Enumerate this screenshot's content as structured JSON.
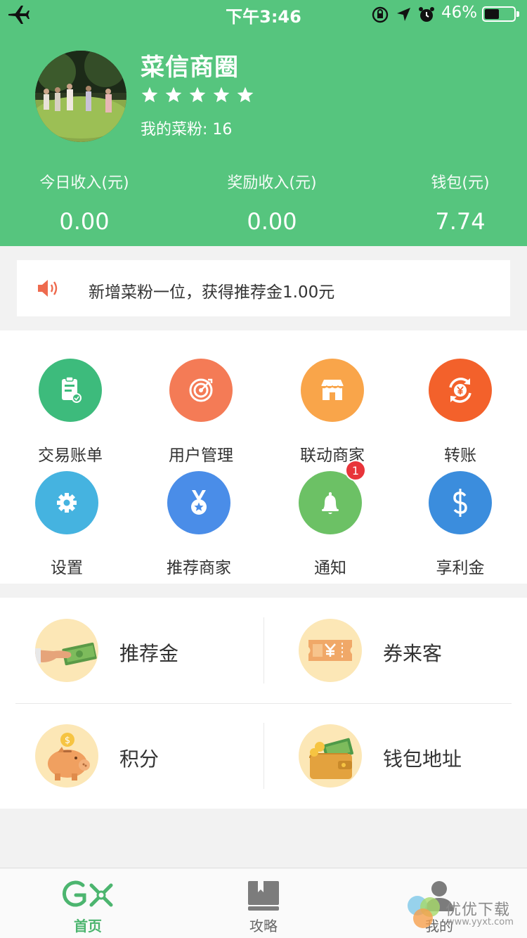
{
  "status_bar": {
    "time": "下午3:46",
    "battery": "46%"
  },
  "profile": {
    "name": "菜信商圈",
    "rating": 5,
    "fans_label": "我的菜粉: 16"
  },
  "stats": [
    {
      "label": "今日收入(元)",
      "value": "0.00"
    },
    {
      "label": "奖励收入(元)",
      "value": "0.00"
    },
    {
      "label": "钱包(元)",
      "value": "7.74"
    }
  ],
  "notice": {
    "text": "新增菜粉一位，获得推荐金1.00元"
  },
  "grid": [
    {
      "label": "交易账单",
      "icon": "clipboard-icon",
      "color": "#3dbb7c"
    },
    {
      "label": "用户管理",
      "icon": "target-icon",
      "color": "#f47b56"
    },
    {
      "label": "联动商家",
      "icon": "store-icon",
      "color": "#f9a54a"
    },
    {
      "label": "转账",
      "icon": "yuan-transfer-icon",
      "color": "#f3612b"
    },
    {
      "label": "设置",
      "icon": "gear-icon",
      "color": "#45b3e0"
    },
    {
      "label": "推荐商家",
      "icon": "medal-icon",
      "color": "#4a8de8"
    },
    {
      "label": "通知",
      "icon": "bell-icon",
      "color": "#6cc165",
      "badge": "1"
    },
    {
      "label": "享利金",
      "icon": "dollar-icon",
      "color": "#3b8ddd"
    }
  ],
  "cards": [
    {
      "label": "推荐金",
      "icon": "money-hand-icon"
    },
    {
      "label": "券来客",
      "icon": "coupon-icon"
    },
    {
      "label": "积分",
      "icon": "piggy-bank-icon"
    },
    {
      "label": "钱包地址",
      "icon": "wallet-icon"
    }
  ],
  "tabs": [
    {
      "label": "首页",
      "icon": "home-logo-icon",
      "active": true
    },
    {
      "label": "攻略",
      "icon": "guide-book-icon",
      "active": false
    },
    {
      "label": "我的",
      "icon": "user-icon",
      "active": false
    }
  ],
  "watermark": {
    "text": "优优下载",
    "url": "www.yyxt.com"
  },
  "colors": {
    "header": "#56c57e",
    "accent": "#4cb56f",
    "badge": "#e8343a"
  }
}
